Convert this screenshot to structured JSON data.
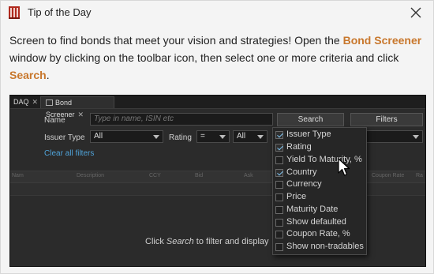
{
  "window": {
    "title": "Tip of the Day"
  },
  "tip": {
    "part1": "Screen to find bonds that meet your vision and strategies! Open the ",
    "bold1": "Bond Screener",
    "part2": " window by clicking on the toolbar icon, then select one or more criteria and click ",
    "bold2": "Search",
    "part3": "."
  },
  "screener": {
    "tabs": [
      {
        "label": "DAQ",
        "close": "✕"
      },
      {
        "label": "Bond Screener",
        "close": "✕"
      }
    ],
    "name_label": "Name",
    "name_placeholder": "Type in name, ISIN etc",
    "search_button": "Search",
    "filters_button": "Filters",
    "issuer_type_label": "Issuer Type",
    "issuer_type_value": "All",
    "rating_label": "Rating",
    "rating_op_value": "=",
    "rating_value": "All",
    "clear_filters": "Clear all filters",
    "grid_columns": [
      "Nam",
      "Description",
      "CCY",
      "Bid",
      "Ask",
      "Coupon Rate",
      "Ra"
    ],
    "empty_prefix": "Click ",
    "empty_italic": "Search",
    "empty_suffix": " to filter and display"
  },
  "filter_dropdown": {
    "options": [
      {
        "label": "Issuer Type",
        "checked": true
      },
      {
        "label": "Rating",
        "checked": true
      },
      {
        "label": "Yield To Maturity, %",
        "checked": false
      },
      {
        "label": "Country",
        "checked": true
      },
      {
        "label": "Currency",
        "checked": false
      },
      {
        "label": "Price",
        "checked": false
      },
      {
        "label": "Maturity Date",
        "checked": false
      },
      {
        "label": "Show defaulted",
        "checked": false
      },
      {
        "label": "Coupon Rate, %",
        "checked": false
      },
      {
        "label": "Show non-tradables",
        "checked": false
      }
    ]
  },
  "colors": {
    "accent": "#c8772c",
    "link": "#4fa3d9",
    "check": "#7ec3f0",
    "panel_bg": "#2b2b2b"
  },
  "icons": {
    "app": "book-stack-icon",
    "close": "close-icon",
    "cursor": "mouse-pointer-icon"
  }
}
